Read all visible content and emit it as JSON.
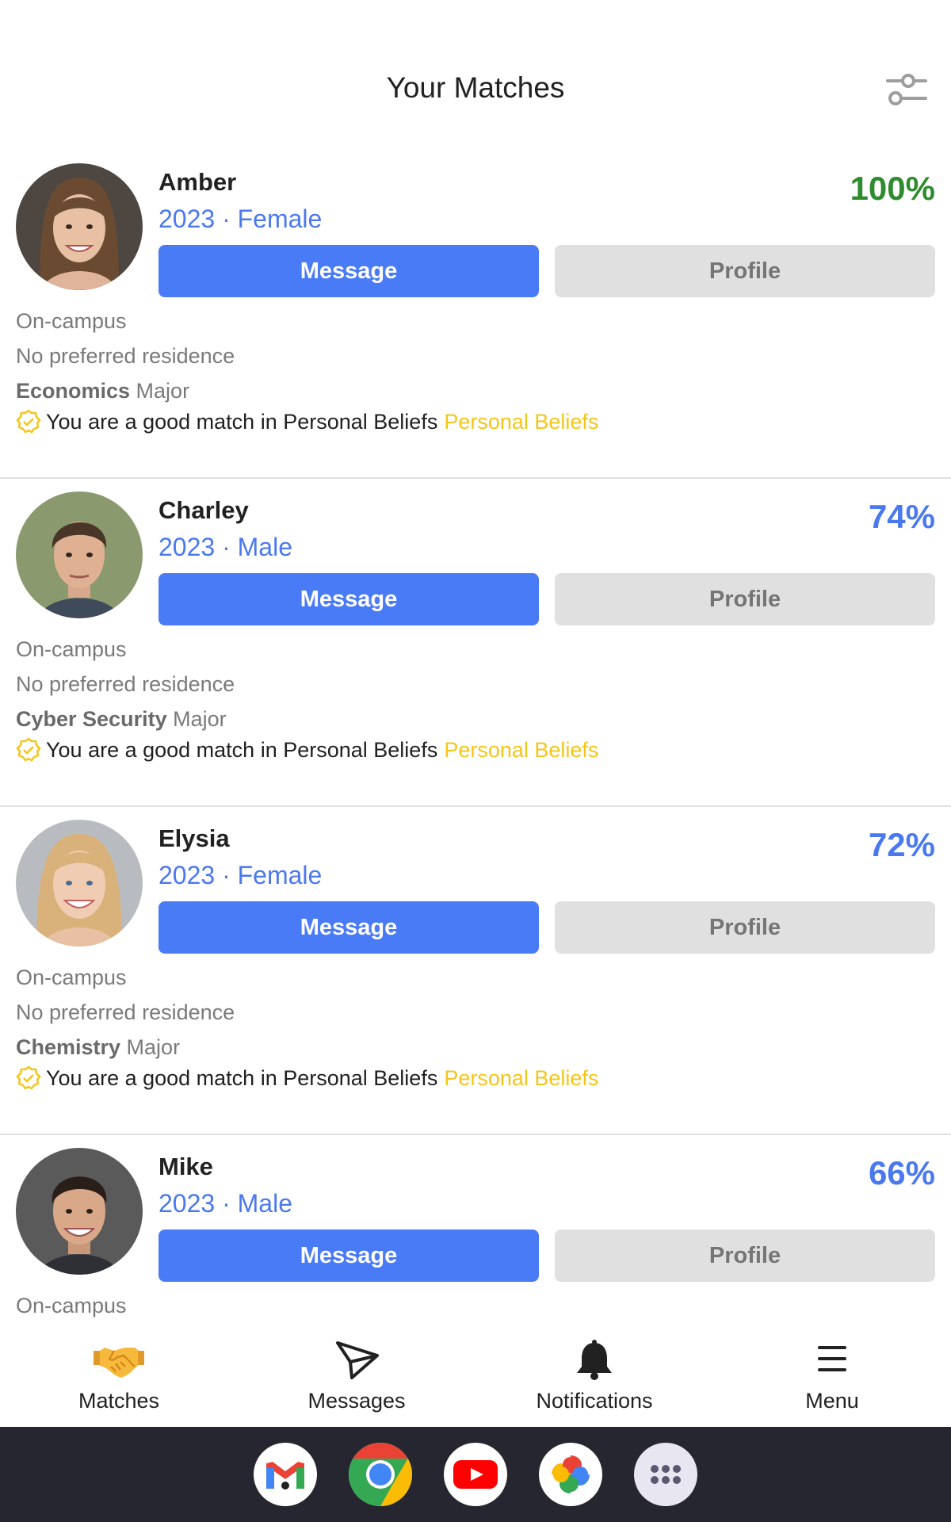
{
  "header": {
    "title": "Your Matches"
  },
  "matches": [
    {
      "name": "Amber",
      "meta": "2023 · Female",
      "percent": "100%",
      "message_label": "Message",
      "profile_label": "Profile",
      "location": "On-campus",
      "residence": "No preferred residence",
      "major": "Economics",
      "major_suffix": " Major",
      "good_match_text": "You are a good match in Personal Beliefs",
      "good_match_highlight": "Personal Beliefs"
    },
    {
      "name": "Charley",
      "meta": "2023 · Male",
      "percent": "74%",
      "message_label": "Message",
      "profile_label": "Profile",
      "location": "On-campus",
      "residence": "No preferred residence",
      "major": "Cyber Security",
      "major_suffix": " Major",
      "good_match_text": "You are a good match in Personal Beliefs",
      "good_match_highlight": "Personal Beliefs"
    },
    {
      "name": "Elysia",
      "meta": "2023 · Female",
      "percent": "72%",
      "message_label": "Message",
      "profile_label": "Profile",
      "location": "On-campus",
      "residence": "No preferred residence",
      "major": "Chemistry",
      "major_suffix": " Major",
      "good_match_text": "You are a good match in Personal Beliefs",
      "good_match_highlight": "Personal Beliefs"
    },
    {
      "name": "Mike",
      "meta": "2023 · Male",
      "percent": "66%",
      "message_label": "Message",
      "profile_label": "Profile",
      "location": "On-campus"
    }
  ],
  "nav": [
    {
      "label": "Matches",
      "icon": "handshake-icon"
    },
    {
      "label": "Messages",
      "icon": "send-icon"
    },
    {
      "label": "Notifications",
      "icon": "bell-icon"
    },
    {
      "label": "Menu",
      "icon": "menu-icon"
    }
  ],
  "dock": [
    "gmail-icon",
    "chrome-icon",
    "youtube-icon",
    "photos-icon",
    "apps-icon"
  ],
  "colors": {
    "accent": "#4a7bf7",
    "top_match": "#2e8b2e",
    "highlight": "#f5c518"
  }
}
